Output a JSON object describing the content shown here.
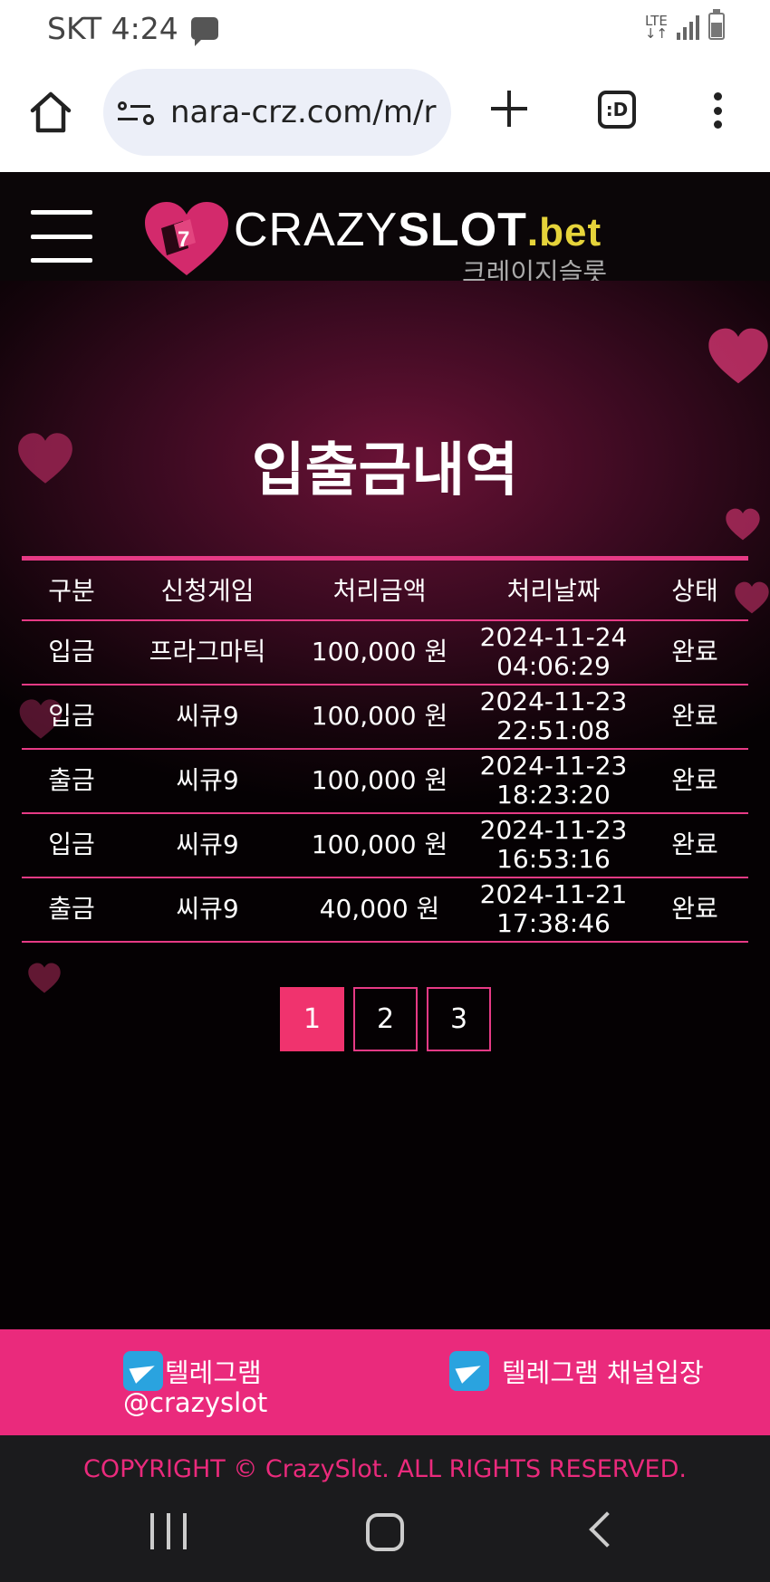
{
  "status_bar": {
    "carrier_time": "SKT 4:24",
    "network": "LTE"
  },
  "browser": {
    "url": "nara-crz.com/m/r",
    "tab_count": ":D"
  },
  "header": {
    "logo_text_thin": "CRAZY",
    "logo_text_bold": "SLOT",
    "logo_text_tld": ".bet",
    "logo_subtitle": "크레이지슬롯"
  },
  "page": {
    "title": "입출금내역"
  },
  "table": {
    "headers": [
      "구분",
      "신청게임",
      "처리금액",
      "처리날짜",
      "상태"
    ],
    "rows": [
      {
        "type": "입금",
        "game": "프라그마틱",
        "amount": "100,000 원",
        "date": "2024-11-24",
        "time": "04:06:29",
        "status": "완료"
      },
      {
        "type": "입금",
        "game": "씨큐9",
        "amount": "100,000 원",
        "date": "2024-11-23",
        "time": "22:51:08",
        "status": "완료"
      },
      {
        "type": "출금",
        "game": "씨큐9",
        "amount": "100,000 원",
        "date": "2024-11-23",
        "time": "18:23:20",
        "status": "완료"
      },
      {
        "type": "입금",
        "game": "씨큐9",
        "amount": "100,000 원",
        "date": "2024-11-23",
        "time": "16:53:16",
        "status": "완료"
      },
      {
        "type": "출금",
        "game": "씨큐9",
        "amount": "40,000 원",
        "date": "2024-11-21",
        "time": "17:38:46",
        "status": "완료"
      }
    ]
  },
  "pagination": {
    "pages": [
      "1",
      "2",
      "3"
    ],
    "active": "1"
  },
  "footer": {
    "telegram_label": "텔레그램",
    "telegram_handle": "@crazyslot",
    "telegram_channel_label": "텔레그램 채널입장",
    "copyright": "COPYRIGHT © CrazySlot. ALL RIGHTS RESERVED."
  },
  "colors": {
    "accent_pink": "#ea2a7c",
    "active_page": "#f0336e",
    "telegram_blue": "#2aa3df",
    "logo_tld": "#e5d33a"
  }
}
